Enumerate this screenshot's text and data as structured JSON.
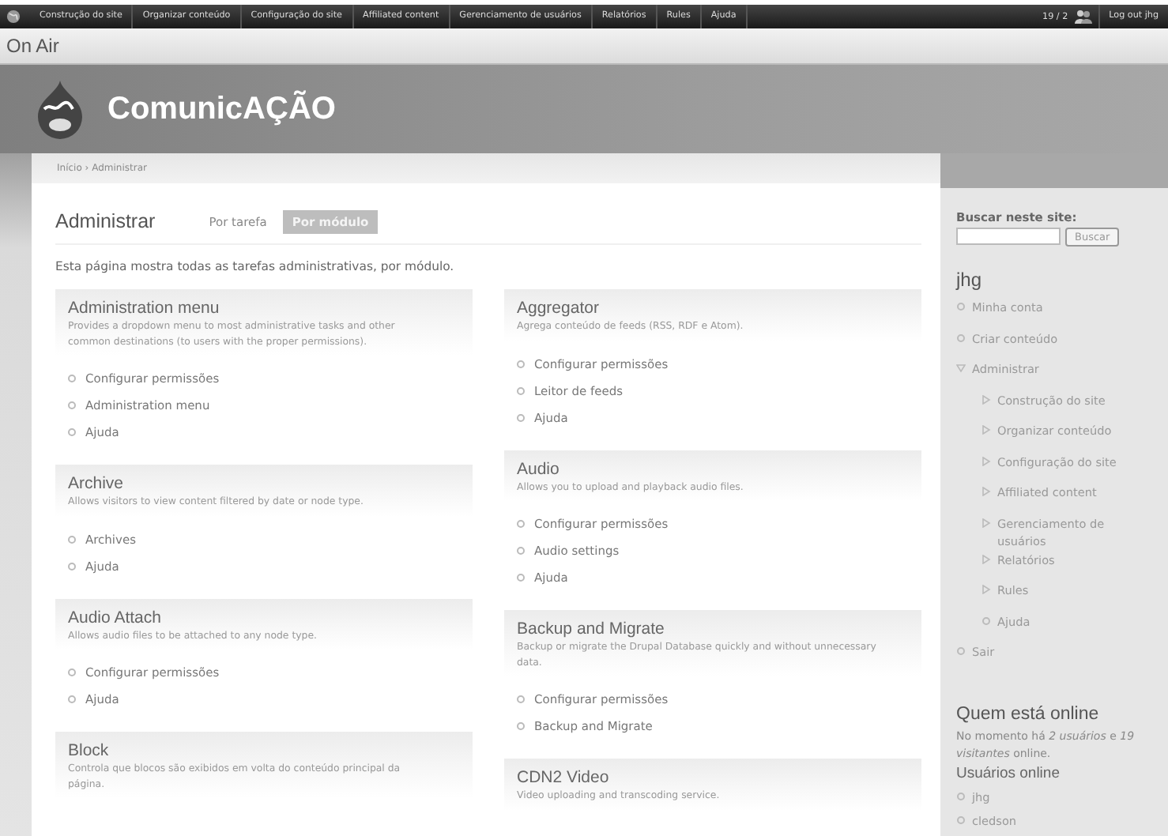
{
  "toolbar": {
    "items": [
      "Construção do site",
      "Organizar conteúdo",
      "Configuração do site",
      "Affiliated content",
      "Gerenciamento de usuários",
      "Relatórios",
      "Rules",
      "Ajuda"
    ],
    "counter": "19 / 2",
    "logout": "Log out jhg"
  },
  "site_bar": {
    "title": "On Air"
  },
  "header": {
    "site_name": "ComunicAÇÃO"
  },
  "breadcrumb": "Início › Administrar",
  "page": {
    "title": "Administrar",
    "tabs": [
      {
        "label": "Por tarefa",
        "selected": false
      },
      {
        "label": "Por módulo",
        "selected": true
      }
    ],
    "description": "Esta página mostra todas as tarefas administrativas, por módulo.",
    "columns": [
      [
        {
          "title": "Administration menu",
          "description": "Provides a dropdown menu to most administrative tasks and other common destinations (to users with the proper permissions).",
          "links": [
            "Configurar permissões",
            "Administration menu",
            "Ajuda"
          ]
        },
        {
          "title": "Archive",
          "description": "Allows visitors to view content filtered by date or node type.",
          "links": [
            "Archives",
            "Ajuda"
          ]
        },
        {
          "title": "Audio Attach",
          "description": "Allows audio files to be attached to any node type.",
          "links": [
            "Configurar permissões",
            "Ajuda"
          ]
        },
        {
          "title": "Block",
          "description": "Controla que blocos são exibidos em volta do conteúdo principal da página."
        }
      ],
      [
        {
          "title": "Aggregator",
          "description": "Agrega conteúdo de feeds (RSS, RDF e Atom).",
          "links": [
            "Configurar permissões",
            "Leitor de feeds",
            "Ajuda"
          ]
        },
        {
          "title": "Audio",
          "description": "Allows you to upload and playback audio files.",
          "links": [
            "Configurar permissões",
            "Audio settings",
            "Ajuda"
          ]
        },
        {
          "title": "Backup and Migrate",
          "description": "Backup or migrate the Drupal Database quickly and without unnecessary data.",
          "links": [
            "Configurar permissões",
            "Backup and Migrate"
          ]
        },
        {
          "title": "CDN2 Video",
          "description": "Video uploading and transcoding service."
        }
      ]
    ]
  },
  "sidebar": {
    "search": {
      "label": "Buscar neste site:",
      "button": "Buscar"
    },
    "user_menu": {
      "title": "jhg",
      "items": [
        {
          "label": "Minha conta",
          "kind": "leaf"
        },
        {
          "label": "Criar conteúdo",
          "kind": "leaf"
        },
        {
          "label": "Administrar",
          "kind": "expanded",
          "children": [
            {
              "label": "Construção do site",
              "kind": "collapsed"
            },
            {
              "label": "Organizar conteúdo",
              "kind": "collapsed"
            },
            {
              "label": "Configuração do site",
              "kind": "collapsed"
            },
            {
              "label": "Affiliated content",
              "kind": "collapsed"
            },
            {
              "label": "Gerenciamento de usuários",
              "kind": "collapsed"
            },
            {
              "label": "Relatórios",
              "kind": "collapsed"
            },
            {
              "label": "Rules",
              "kind": "collapsed"
            },
            {
              "label": "Ajuda",
              "kind": "leaf"
            }
          ]
        },
        {
          "label": "Sair",
          "kind": "leaf"
        }
      ]
    },
    "online": {
      "title": "Quem está online",
      "text": "No momento há *2 usuários* e *19 visitantes* online.",
      "subtitle": "Usuários online",
      "users": [
        "jhg",
        "cledson"
      ]
    }
  }
}
